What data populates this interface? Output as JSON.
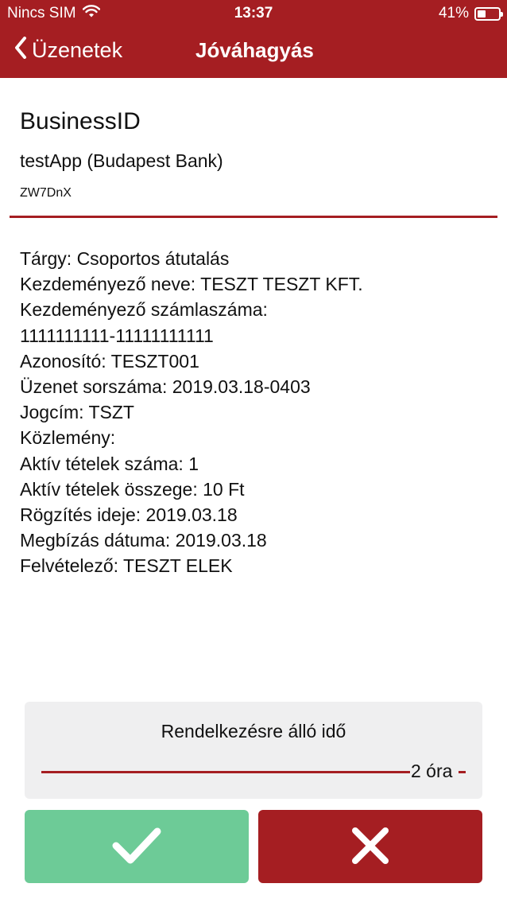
{
  "status_bar": {
    "carrier": "Nincs SIM",
    "time": "13:37",
    "battery_percent": "41%",
    "battery_level": 0.41,
    "wifi_icon": "wifi-icon"
  },
  "nav": {
    "back_label": "Üzenetek",
    "title": "Jóváhagyás"
  },
  "business": {
    "name": "BusinessID",
    "app": "testApp (Budapest Bank)",
    "code": "ZW7DnX"
  },
  "details": [
    "Tárgy: Csoportos átutalás",
    "Kezdeményező neve: TESZT TESZT KFT.",
    "Kezdeményező számlaszáma:",
    "1111111111-11111111111",
    "Azonosító: TESZT001",
    "Üzenet sorszáma: 2019.03.18-0403",
    "Jogcím: TSZT",
    "Közlemény:",
    "Aktív tételek száma: 1",
    "Aktív tételek összege: 10 Ft",
    "Rögzítés ideje: 2019.03.18",
    "Megbízás dátuma: 2019.03.18",
    "Felvételező: TESZT ELEK"
  ],
  "time_remaining": {
    "label": "Rendelkezésre álló idő",
    "value": "2 óra"
  },
  "actions": {
    "approve_icon": "checkmark-icon",
    "reject_icon": "x-icon"
  },
  "colors": {
    "brand_red": "#a51e22",
    "approve_green": "#6dcb97",
    "panel_gray": "#efeff0"
  }
}
